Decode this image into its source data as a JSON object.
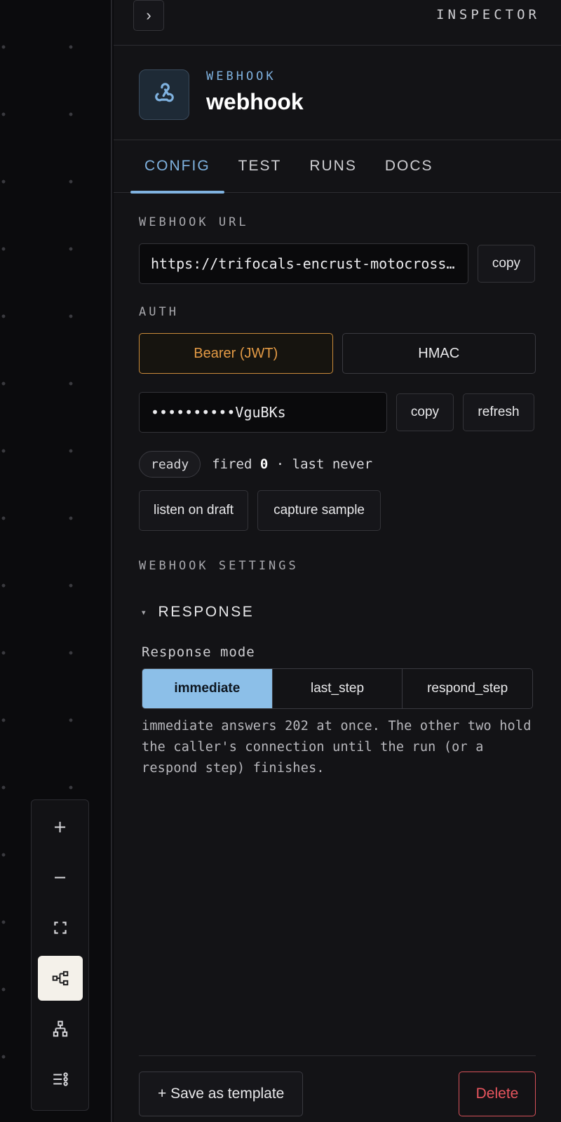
{
  "inspector": {
    "title": "INSPECTOR",
    "collapse_glyph": "›"
  },
  "node": {
    "kind": "WEBHOOK",
    "name": "webhook",
    "icon": "webhook-icon"
  },
  "tabs": [
    {
      "label": "CONFIG",
      "active": true
    },
    {
      "label": "TEST",
      "active": false
    },
    {
      "label": "RUNS",
      "active": false
    },
    {
      "label": "DOCS",
      "active": false
    }
  ],
  "webhook_url": {
    "label": "WEBHOOK URL",
    "value": "https://trifocals-encrust-motocross.hooks.app/webhook",
    "copy_label": "copy"
  },
  "auth": {
    "label": "AUTH",
    "options": [
      {
        "label": "Bearer (JWT)",
        "active": true
      },
      {
        "label": "HMAC",
        "active": false
      }
    ],
    "token": "••••••••••VguBKs",
    "copy_label": "copy",
    "refresh_label": "refresh"
  },
  "status": {
    "badge": "ready",
    "fired_prefix": "fired",
    "fired_count": "0",
    "last_text": "· last never"
  },
  "actions": {
    "listen_label": "listen on draft",
    "capture_label": "capture sample"
  },
  "settings": {
    "label": "WEBHOOK SETTINGS",
    "section_title": "RESPONSE",
    "caret": "▾",
    "response_mode_label": "Response mode",
    "modes": [
      {
        "label": "immediate",
        "active": true
      },
      {
        "label": "last_step",
        "active": false
      },
      {
        "label": "respond_step",
        "active": false
      }
    ],
    "help": "immediate answers 202 at once. The other two hold the caller's connection until the run (or a respond step) finishes."
  },
  "footer": {
    "save_label": "+ Save as template",
    "delete_label": "Delete"
  },
  "toolbar": {
    "zoom_in": "+",
    "zoom_out": "−"
  },
  "colors": {
    "accent": "#7fb2e0",
    "auth_active": "#e39a45",
    "danger": "#e8555e",
    "segment_active": "#8cbfe8"
  }
}
